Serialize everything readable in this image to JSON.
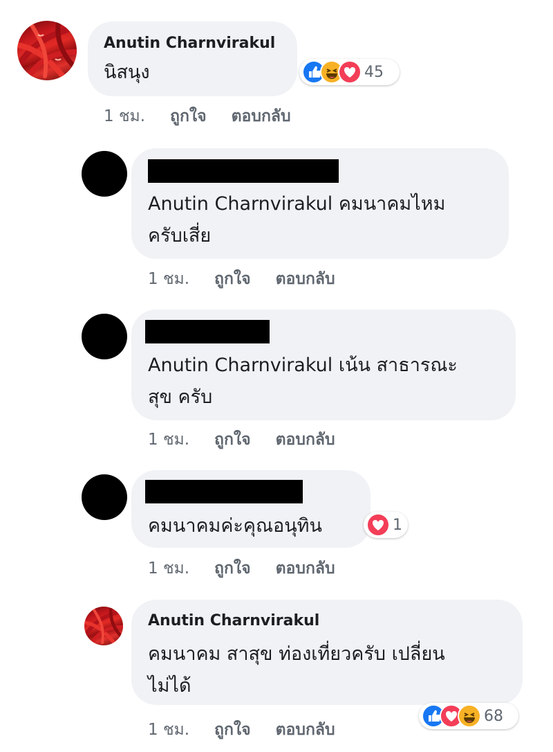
{
  "comments": [
    {
      "name": "Anutin Charnvirakul",
      "text_lines": [
        "นิสนุง"
      ],
      "time": "1 ชม.",
      "like": "ถูกใจ",
      "reply": "ตอบกลับ",
      "reactions": {
        "icons": [
          "like-icon",
          "haha-icon",
          "love-icon"
        ],
        "count": "45"
      }
    },
    {
      "name": "",
      "text_lines": [
        "Anutin Charnvirakul คมนาคมไหม",
        "ครับเสี่ย"
      ],
      "time": "1 ชม.",
      "like": "ถูกใจ",
      "reply": "ตอบกลับ"
    },
    {
      "name": "",
      "text_lines": [
        "Anutin Charnvirakul เน้น สาธารณะ",
        "สุข ครับ"
      ],
      "time": "1 ชม.",
      "like": "ถูกใจ",
      "reply": "ตอบกลับ"
    },
    {
      "name": "",
      "text_lines": [
        "คมนาคมค่ะคุณอนุทิน"
      ],
      "time": "1 ชม.",
      "like": "ถูกใจ",
      "reply": "ตอบกลับ",
      "reactions": {
        "icons": [
          "love-icon"
        ],
        "count": "1"
      }
    },
    {
      "name": "Anutin Charnvirakul",
      "text_lines": [
        "คมนาคม สาสุข ท่องเที่ยวครับ เปลี่ยน",
        "ไม่ได้"
      ],
      "time": "1 ชม.",
      "like": "ถูกใจ",
      "reply": "ตอบกลับ",
      "reactions": {
        "icons": [
          "like-icon",
          "love-icon",
          "haha-icon"
        ],
        "count": "68"
      }
    }
  ],
  "colors": {
    "bubble": "#f0f2f5",
    "like_blue": "#1877f2",
    "love_red": "#f33e58",
    "haha_yellow": "#f7b125",
    "meta_gray": "#606770"
  }
}
